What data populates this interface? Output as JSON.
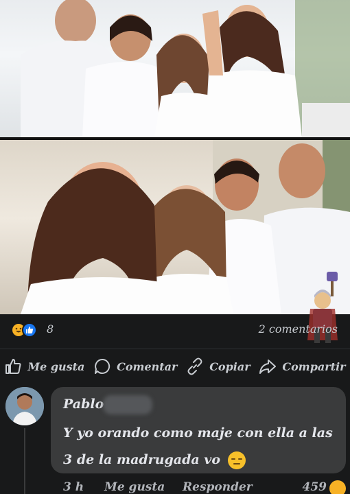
{
  "post": {
    "reaction_count": "8",
    "comment_count": "2 comentarios",
    "reaction_icons": [
      "haha-icon",
      "like-icon"
    ]
  },
  "actions": {
    "like": "Me gusta",
    "comment": "Comentar",
    "copy": "Copiar",
    "share": "Compartir"
  },
  "comment": {
    "author": "Pablo",
    "text": "Y yo orando como maje con ella a las 3 de la madrugada vo",
    "emoji": "pensive-face",
    "time": "3 h",
    "like_label": "Me gusta",
    "reply_label": "Responder",
    "reaction_count": "459"
  },
  "colors": {
    "background": "#18191a",
    "bubble": "#3a3b3c",
    "like_blue": "#1877f2",
    "haha_yellow": "#f7b125"
  }
}
